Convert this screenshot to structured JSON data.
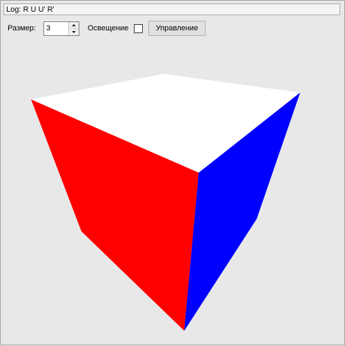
{
  "log": {
    "text": "Log: R U U' R'"
  },
  "toolbar": {
    "size_label": "Размер:",
    "size_value": "3",
    "lighting_label": "Освещение",
    "lighting_checked": false,
    "control_button_label": "Управление"
  },
  "cube": {
    "colors": {
      "top": "#ffffff",
      "left": "#ff0000",
      "right": "#0000ff",
      "background": "#e8e8e8"
    }
  }
}
